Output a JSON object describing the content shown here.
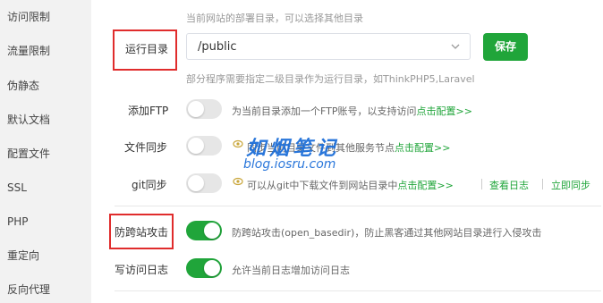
{
  "sidebar": {
    "items": [
      {
        "label": "访问限制"
      },
      {
        "label": "流量限制"
      },
      {
        "label": "伪静态"
      },
      {
        "label": "默认文档"
      },
      {
        "label": "配置文件"
      },
      {
        "label": "SSL"
      },
      {
        "label": "PHP"
      },
      {
        "label": "重定向"
      },
      {
        "label": "反向代理"
      }
    ]
  },
  "deploy_hint": "当前网站的部署目录，可以选择其他目录",
  "run_dir": {
    "label": "运行目录",
    "value": "/public",
    "save_label": "保存",
    "hint": "部分程序需要指定二级目录作为运行目录，如ThinkPHP5,Laravel"
  },
  "ftp": {
    "label": "添加FTP",
    "desc": "为当前目录添加一个FTP账号，以支持访问",
    "link": "点击配置>>"
  },
  "file_sync": {
    "label": "文件同步",
    "desc": "同步当前目录文件到其他服务节点",
    "link": "点击配置>>"
  },
  "git_sync": {
    "label": "git同步",
    "desc": "可以从git中下载文件到网站目录中",
    "link": "点击配置>>",
    "log_link": "查看日志",
    "sync_link": "立即同步"
  },
  "anti_xss": {
    "label": "防跨站攻击",
    "desc": "防跨站攻击(open_basedir)，防止黑客通过其他网站目录进行入侵攻击"
  },
  "access_log": {
    "label": "写访问日志",
    "desc": "允许当前日志增加访问日志"
  },
  "watermark": {
    "title": "如烟笔记",
    "subtitle": "blog.iosru.com"
  },
  "colors": {
    "accent": "#20a53a",
    "highlight_box": "#e02c2c",
    "watermark": "#1e6fd9"
  }
}
